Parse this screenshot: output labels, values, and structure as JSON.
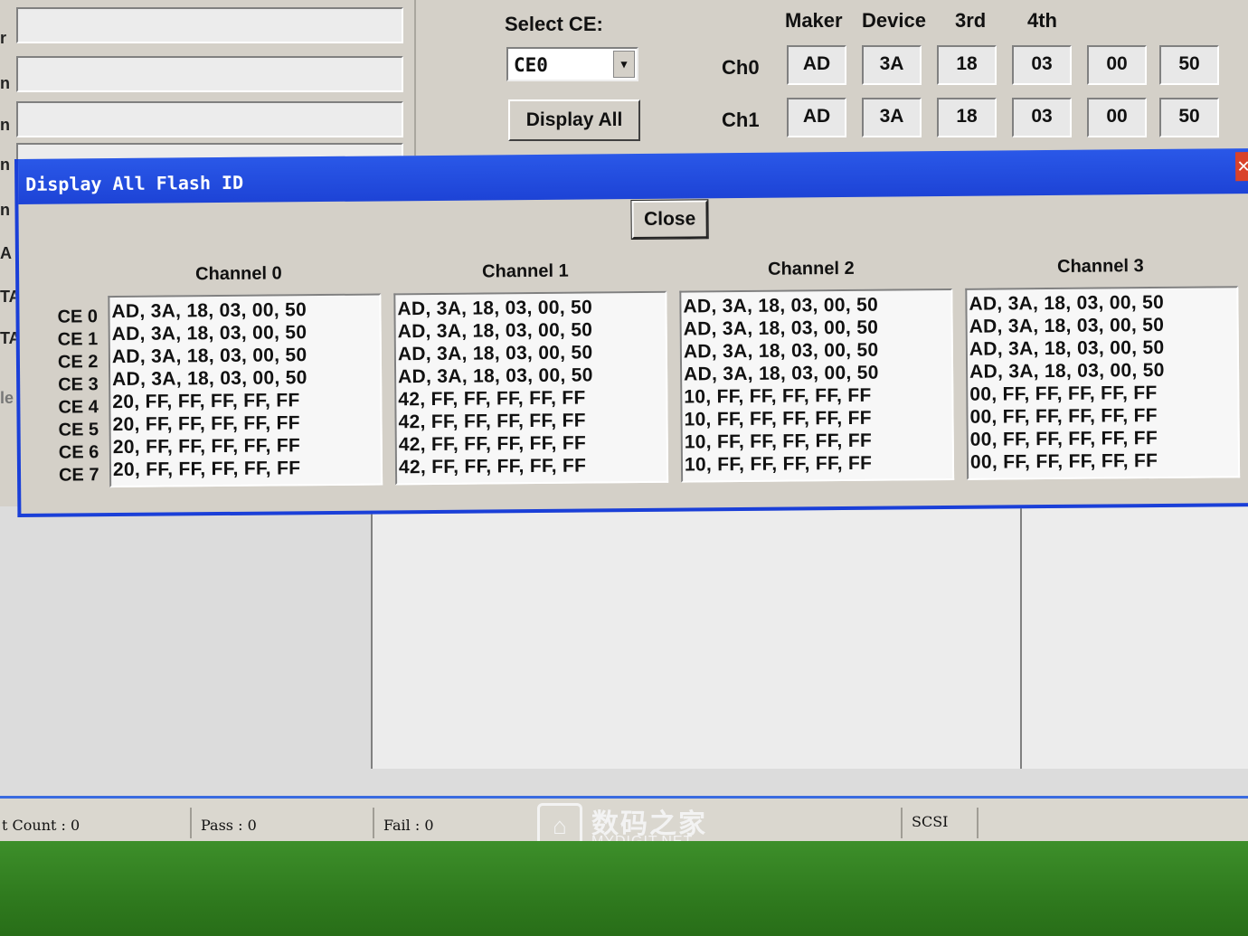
{
  "background_window": {
    "left_labels": [
      "r",
      "n",
      "n",
      "n",
      "n",
      "A",
      "TA",
      "TA",
      "le"
    ],
    "select_ce_label": "Select CE:",
    "ce_dropdown_value": "CE0",
    "display_all_button": "Display All",
    "id_columns": [
      "Maker",
      "Device",
      "3rd",
      "4th"
    ],
    "rows": [
      {
        "label": "Ch0",
        "values": [
          "AD",
          "3A",
          "18",
          "03",
          "00",
          "50"
        ]
      },
      {
        "label": "Ch1",
        "values": [
          "AD",
          "3A",
          "18",
          "03",
          "00",
          "50"
        ]
      }
    ]
  },
  "dialog": {
    "title": "Display All Flash ID",
    "close_button": "Close",
    "ce_labels": [
      "CE 0",
      "CE 1",
      "CE 2",
      "CE 3",
      "CE 4",
      "CE 5",
      "CE 6",
      "CE 7"
    ],
    "channels": [
      {
        "name": "Channel 0",
        "lines": [
          "AD, 3A, 18, 03, 00, 50",
          "AD, 3A, 18, 03, 00, 50",
          "AD, 3A, 18, 03, 00, 50",
          "AD, 3A, 18, 03, 00, 50",
          "20, FF, FF, FF, FF, FF",
          "20, FF, FF, FF, FF, FF",
          "20, FF, FF, FF, FF, FF",
          "20, FF, FF, FF, FF, FF"
        ]
      },
      {
        "name": "Channel 1",
        "lines": [
          "AD, 3A, 18, 03, 00, 50",
          "AD, 3A, 18, 03, 00, 50",
          "AD, 3A, 18, 03, 00, 50",
          "AD, 3A, 18, 03, 00, 50",
          "42, FF, FF, FF, FF, FF",
          "42, FF, FF, FF, FF, FF",
          "42, FF, FF, FF, FF, FF",
          "42, FF, FF, FF, FF, FF"
        ]
      },
      {
        "name": "Channel 2",
        "lines": [
          "AD, 3A, 18, 03, 00, 50",
          "AD, 3A, 18, 03, 00, 50",
          "AD, 3A, 18, 03, 00, 50",
          "AD, 3A, 18, 03, 00, 50",
          "10, FF, FF, FF, FF, FF",
          "10, FF, FF, FF, FF, FF",
          "10, FF, FF, FF, FF, FF",
          "10, FF, FF, FF, FF, FF"
        ]
      },
      {
        "name": "Channel 3",
        "lines": [
          "AD, 3A, 18, 03, 00, 50",
          "AD, 3A, 18, 03, 00, 50",
          "AD, 3A, 18, 03, 00, 50",
          "AD, 3A, 18, 03, 00, 50",
          "00, FF, FF, FF, FF, FF",
          "00, FF, FF, FF, FF, FF",
          "00, FF, FF, FF, FF, FF",
          "00, FF, FF, FF, FF, FF"
        ]
      }
    ]
  },
  "status_bar": {
    "count": "t Count : 0",
    "pass": "Pass : 0",
    "fail": "Fail : 0",
    "interface": "SCSI"
  },
  "watermark": {
    "icon": "home-logo-icon",
    "chinese": "数码之家",
    "english": "MYDIGIT.NET"
  },
  "colors": {
    "titlebar": "#2a58e8",
    "dialog_border": "#1a3fd8",
    "window_face": "#d4d0c8",
    "desktop_green": "#3d8f2a"
  }
}
